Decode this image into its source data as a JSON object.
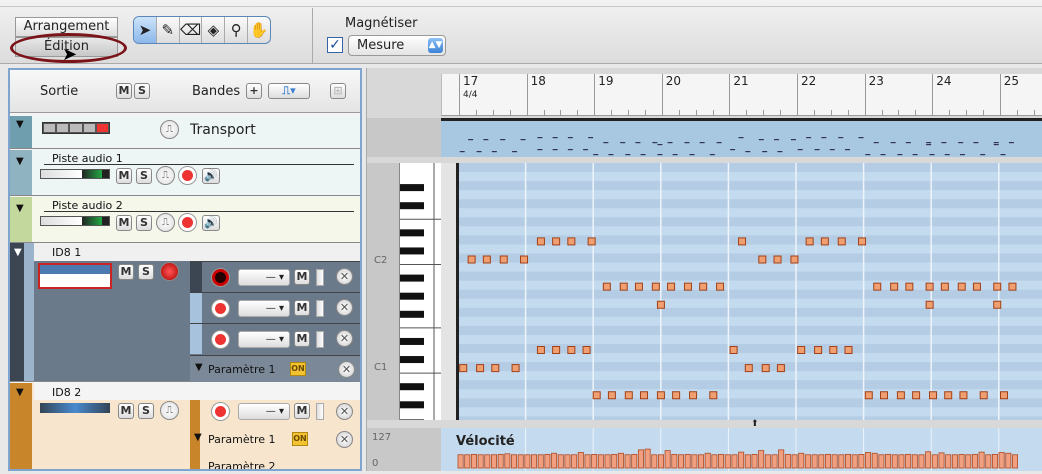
{
  "toolbar": {
    "mode_arrangement": "Arrangement",
    "mode_edition": "Édition",
    "tools": [
      {
        "name": "pointer-tool",
        "glyph": "➤"
      },
      {
        "name": "pencil-tool",
        "glyph": "✎"
      },
      {
        "name": "eraser-tool",
        "glyph": "⌫"
      },
      {
        "name": "razor-tool",
        "glyph": "◈"
      },
      {
        "name": "zoom-tool",
        "glyph": "⚲"
      },
      {
        "name": "hand-tool",
        "glyph": "✋"
      }
    ],
    "snap_label": "Magnétiser",
    "snap_checked": true,
    "snap_value": "Mesure"
  },
  "left": {
    "header": {
      "output": "Sortie",
      "m": "M",
      "s": "S",
      "bands": "Bandes",
      "plus": "+"
    },
    "transport": "Transport",
    "tracks": [
      {
        "name": "Piste audio 1",
        "color": "#8fb3c0",
        "bg": "#eef5f5"
      },
      {
        "name": "Piste audio 2",
        "color": "#c3d89c",
        "bg": "#f4f7ea"
      }
    ],
    "id8_1": {
      "name": "ID8 1",
      "param": "Paramètre 1",
      "on": "ON",
      "dash": "—"
    },
    "id8_2": {
      "name": "ID8 2",
      "param1": "Paramètre 1",
      "param2": "Paramètre 2",
      "on": "ON",
      "dash": "—"
    }
  },
  "ruler": {
    "bars": [
      "17",
      "18",
      "19",
      "20",
      "21",
      "22",
      "23",
      "24",
      "25"
    ],
    "signature": "4/4"
  },
  "piano": {
    "labels": {
      "c2": "C2",
      "c1": "C1"
    }
  },
  "velocity": {
    "label": "Vélocité",
    "max": "127",
    "min": "0"
  },
  "notes": [
    {
      "pitch": "D2",
      "beats": [
        4.7,
        5.6,
        6.5,
        7.7,
        16.6,
        20.6,
        21.5,
        22.5,
        23.7
      ]
    },
    {
      "pitch": "C2",
      "beats": [
        0.6,
        1.5,
        2.5,
        3.7,
        17.8,
        18.7,
        19.7
      ]
    },
    {
      "pitch": "A1",
      "beats": [
        8.6,
        9.6,
        10.5,
        11.5,
        12.4,
        13.4,
        14.3,
        15.3,
        24.6,
        25.6,
        26.5,
        27.7,
        28.6,
        29.6,
        30.5,
        31.7,
        32.6
      ]
    },
    {
      "pitch": "G1",
      "beats": [
        11.8,
        27.7,
        31.7
      ]
    },
    {
      "pitch": "D1",
      "beats": [
        4.7,
        5.6,
        6.5,
        7.4,
        16.1,
        20.1,
        21.1,
        22.0,
        22.9
      ]
    },
    {
      "pitch": "C1",
      "beats": [
        0.1,
        1.1,
        2.0,
        3.2,
        17.0,
        18.0,
        18.9
      ]
    },
    {
      "pitch": "A0",
      "beats": [
        8.0,
        8.9,
        9.9,
        10.8,
        11.8,
        12.7,
        13.7,
        14.9,
        24.1,
        25.0,
        26.0,
        26.9,
        27.9,
        28.8,
        29.7,
        30.9,
        32.1
      ]
    }
  ],
  "velocities": [
    70,
    70,
    72,
    70,
    70,
    70,
    72,
    75,
    70,
    70,
    70,
    70,
    70,
    72,
    78,
    70,
    70,
    70,
    82,
    70,
    72,
    70,
    70,
    72,
    78,
    70,
    72,
    96,
    100,
    70,
    70,
    92,
    72,
    70,
    72,
    70,
    70,
    78,
    70,
    72,
    70,
    70,
    84,
    70,
    72,
    92,
    70,
    70,
    96,
    72,
    70,
    78,
    70,
    70,
    70,
    72,
    70,
    70,
    72,
    70,
    72,
    82,
    78,
    70,
    72,
    70,
    70,
    72,
    70,
    70,
    86,
    70,
    80,
    70,
    70,
    72,
    70,
    72,
    84,
    70,
    72,
    82,
    78,
    70
  ]
}
